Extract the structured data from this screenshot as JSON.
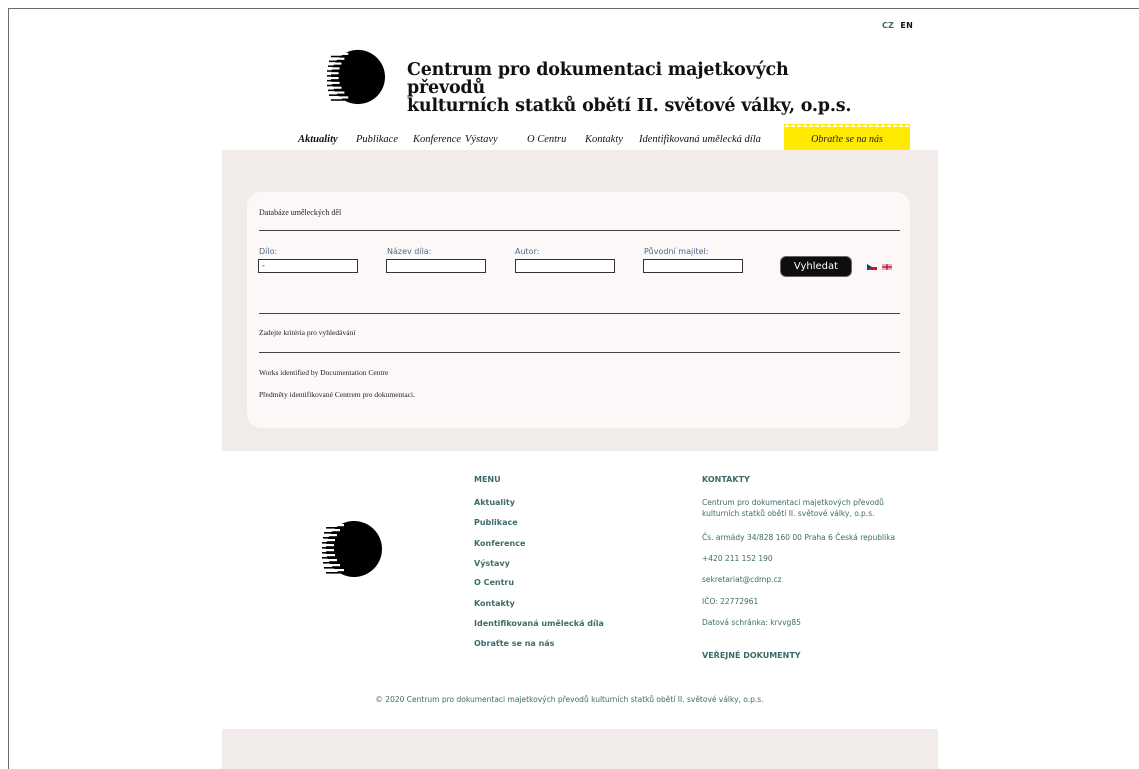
{
  "lang": {
    "cz": "CZ",
    "en": "EN"
  },
  "site": {
    "title_line1": "Centrum pro dokumentaci majetkových převodů",
    "title_line2": "kulturních statků obětí II. světové války, o.p.s."
  },
  "nav": {
    "items": [
      "Aktuality",
      "Publikace",
      "Konference",
      "Výstavy",
      "O Centru",
      "Kontakty",
      "Identifikovaná umělecká díla"
    ],
    "active": "Aktuality",
    "cta": "Obraťte se na nás"
  },
  "search": {
    "title": "Databáze uměleckých děl",
    "fields": [
      {
        "label": "Dílo:",
        "value": "-"
      },
      {
        "label": "Název díla:",
        "value": ""
      },
      {
        "label": "Autor:",
        "value": ""
      },
      {
        "label": "Původní majitel:",
        "value": ""
      }
    ],
    "button": "Vyhledat",
    "hint": "Zadejte kritéria pro vyhledávání",
    "note_en": "Works identified by Documentation Centre",
    "note_cz": "Předměty identifikované Centrem pro dokumentaci."
  },
  "footer": {
    "menu_heading": "MENU",
    "menu": [
      "Aktuality",
      "Publikace",
      "Konference",
      "Výstavy",
      "O Centru",
      "Kontakty",
      "Identifikovaná umělecká díla",
      "Obraťte se na nás"
    ],
    "contacts_heading": "KONTAKTY",
    "org_line1": "Centrum pro dokumentaci majetkových převodů",
    "org_line2": "kulturních statků obětí II. světové války, o.p.s.",
    "address": "Čs. armády 34/828 160 00 Praha 6 Česká republika",
    "phone": "+420 211 152 190",
    "email": "sekretariat@cdmp.cz",
    "ico": "IČO: 22772961",
    "databox": "Datová schránka: krvvg85",
    "public_docs": "VEŘEJNÉ DOKUMENTY",
    "copyright": "© 2020 Centrum pro dokumentaci majetkových převodů kulturních statků obětí II. světové války, o.p.s."
  }
}
